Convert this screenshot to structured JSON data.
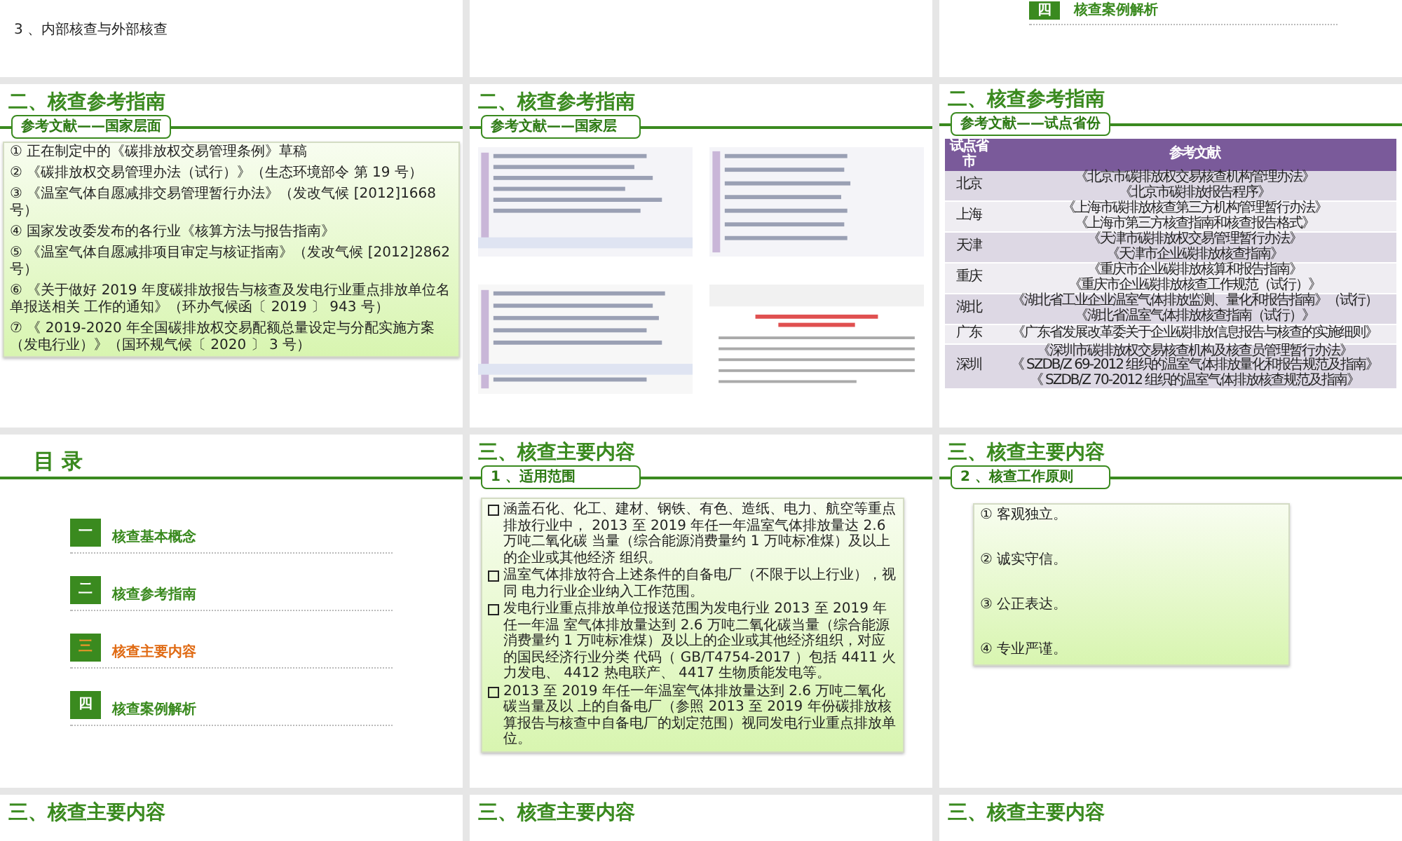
{
  "slides": [
    {
      "kind": "text_end",
      "lines": [
        "3 、内部核查与外部核查"
      ]
    },
    {
      "kind": "blank"
    },
    {
      "kind": "toc_end",
      "number": "四",
      "label": "核查案例解析"
    },
    {
      "kind": "list",
      "title": "二、核查参考指南",
      "subtitle": "参考文献——国家层面",
      "items": [
        "① 正在制定中的《碳排放权交易管理条例》草稿",
        "② 《碳排放权交易管理办法（试行）》（生态环境部令 第 19 号）",
        "③ 《温室气体自愿减排交易管理暂行办法》（发改气候 [2012]1668 号）",
        "④ 国家发改委发布的各行业《核算方法与报告指南》",
        "⑤ 《温室气体自愿减排项目审定与核证指南》（发改气候 [2012]2862 号）",
        "⑥ 《关于做好 2019 年度碳排放报告与核查及发电行业重点排放单位名单报送相关 工作的通知》（环办气候函〔 2019 〕 943 号）",
        "⑦ 《 2019-2020 年全国碳排放权交易配额总量设定与分配实施方案（发电行业）》（国环规气候〔 2020 〕 3 号）"
      ]
    },
    {
      "kind": "images",
      "title": "二、核查参考指南",
      "subtitle": "参考文献——国家层"
    },
    {
      "kind": "table",
      "title": "二、核查参考指南",
      "subtitle": "参考文献——试点省份",
      "columns": [
        "试点省市",
        "参考文献"
      ],
      "rows": [
        {
          "city": "北京",
          "docs": [
            "《北京市碳排放权交易核查机构管理办法》",
            "《北京市碳排放报告程序》"
          ]
        },
        {
          "city": "上海",
          "docs": [
            "《上海市碳排放核查第三方机构管理暂行办法》",
            "《上海市第三方核查指南和核查报告格式》"
          ]
        },
        {
          "city": "天津",
          "docs": [
            "《天津市碳排放权交易管理暂行办法》",
            "《天津市企业碳排放核查指南》"
          ]
        },
        {
          "city": "重庆",
          "docs": [
            "《重庆市企业碳排放核算和报告指南》",
            "《重庆市企业碳排放核查工作规范（试行）》"
          ]
        },
        {
          "city": "湖北",
          "docs": [
            "《湖北省工业企业温室气体排放监测、量化和报告指南》（试行）",
            "《湖北省温室气体排放核查指南（试行）》"
          ]
        },
        {
          "city": "广东",
          "docs": [
            "《广东省发展改革委关于企业碳排放信息报告与核查的实施细则》"
          ]
        },
        {
          "city": "深圳",
          "docs": [
            "《深圳市碳排放权交易核查机构及核查员管理暂行办法》",
            "《 SZDB/Z 69-2012 组织的温室气体排放量化和报告规范及指南》",
            "《 SZDB/Z 70-2012 组织的温室气体排放核查规范及指南》"
          ]
        }
      ]
    },
    {
      "kind": "toc",
      "title": "目 录",
      "items": [
        {
          "number": "一",
          "label": "核查基本概念",
          "selected": false
        },
        {
          "number": "二",
          "label": "核查参考指南",
          "selected": false
        },
        {
          "number": "三",
          "label": "核查主要内容",
          "selected": true
        },
        {
          "number": "四",
          "label": "核查案例解析",
          "selected": false
        }
      ]
    },
    {
      "kind": "bullets",
      "title": "三、核查主要内容",
      "subtitle": "1 、适用范围",
      "items": [
        "涵盖石化、化工、建材、钢铁、有色、造纸、电力、航空等重点排放行业中， 2013 至 2019 年任一年温室气体排放量达 2.6 万吨二氧化碳 当量（综合能源消费量约 1 万吨标准煤）及以上的企业或其他经济 组织。",
        "温室气体排放符合上述条件的自备电厂（不限于以上行业），视同 电力行业企业纳入工作范围。",
        "发电行业重点排放单位报送范围为发电行业 2013 至 2019 年任一年温 室气体排放量达到 2.6 万吨二氧化碳当量（综合能源消费量约 1 万吨标准煤）及以上的企业或其他经济组织，对应的国民经济行业分类 代码（ GB/T4754-2017 ）包括 4411 火力发电、 4412 热电联产、 4417 生物质能发电等。",
        "2013 至 2019 年任一年温室气体排放量达到 2.6 万吨二氧化碳当量及以 上的自备电厂（参照 2013 至 2019 年份碳排放核算报告与核查中自备电厂的划定范围）视同发电行业重点排放单位。"
      ]
    },
    {
      "kind": "principles",
      "title": "三、核查主要内容",
      "subtitle": "2 、核查工作原则",
      "items": [
        "① 客观独立。",
        "② 诚实守信。",
        "③ 公正表达。",
        "④ 专业严谨。"
      ]
    },
    {
      "kind": "title_only",
      "title": "三、核查主要内容"
    },
    {
      "kind": "title_only",
      "title": "三、核查主要内容"
    },
    {
      "kind": "title_only",
      "title": "三、核查主要内容"
    }
  ]
}
